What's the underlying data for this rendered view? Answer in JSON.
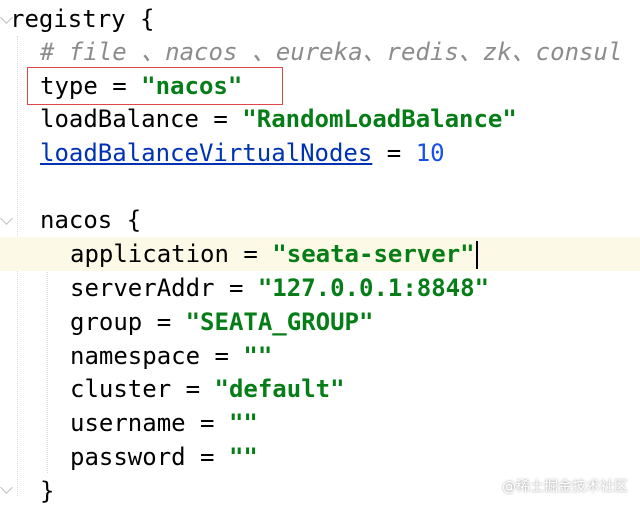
{
  "code": {
    "line_registry_open": "registry {",
    "line_comment": "# file 、nacos 、eureka、redis、zk、consul",
    "type_key": "type = ",
    "type_value": "\"nacos\"",
    "loadbalance_key": "loadBalance = ",
    "loadbalance_value": "\"RandomLoadBalance\"",
    "vnodes_key": "loadBalanceVirtualNodes",
    "vnodes_eq": " = ",
    "vnodes_value": "10",
    "nacos_open": "nacos {",
    "application_key": "application = ",
    "application_value": "\"seata-server\"",
    "serveraddr_key": "serverAddr = ",
    "serveraddr_value": "\"127.0.0.1:8848\"",
    "group_key": "group = ",
    "group_value": "\"SEATA_GROUP\"",
    "namespace_key": "namespace = ",
    "namespace_value": "\"\"",
    "cluster_key": "cluster = ",
    "cluster_value": "\"default\"",
    "username_key": "username = ",
    "username_value": "\"\"",
    "password_key": "password = ",
    "password_value": "\"\"",
    "nacos_close": "}"
  },
  "watermark": "@稀土掘金技术社区",
  "colors": {
    "string": "#067d17",
    "number": "#1750eb",
    "comment": "#8c8c8c",
    "link_key": "#0033b3",
    "highlight_box": "#e0454a",
    "current_line": "#fcfae6"
  }
}
